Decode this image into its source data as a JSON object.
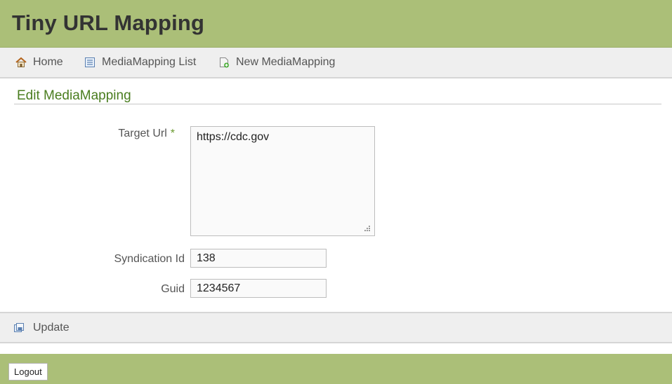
{
  "app": {
    "title": "Tiny URL Mapping"
  },
  "nav": {
    "items": [
      {
        "label": "Home",
        "icon": "home-icon"
      },
      {
        "label": "MediaMapping List",
        "icon": "list-icon"
      },
      {
        "label": "New MediaMapping",
        "icon": "new-document-icon"
      }
    ]
  },
  "page": {
    "title": "Edit MediaMapping"
  },
  "form": {
    "target_url": {
      "label": "Target Url",
      "required_marker": "*",
      "value": "https://cdc.gov"
    },
    "syndication_id": {
      "label": "Syndication Id",
      "value": "138"
    },
    "guid": {
      "label": "Guid",
      "value": "1234567"
    }
  },
  "actions": {
    "update_label": "Update",
    "update_icon": "save-icon"
  },
  "footer": {
    "logout_label": "Logout"
  },
  "colors": {
    "header_bg": "#abbf78",
    "title_green": "#4a7d1f",
    "nav_bg": "#efefef"
  }
}
